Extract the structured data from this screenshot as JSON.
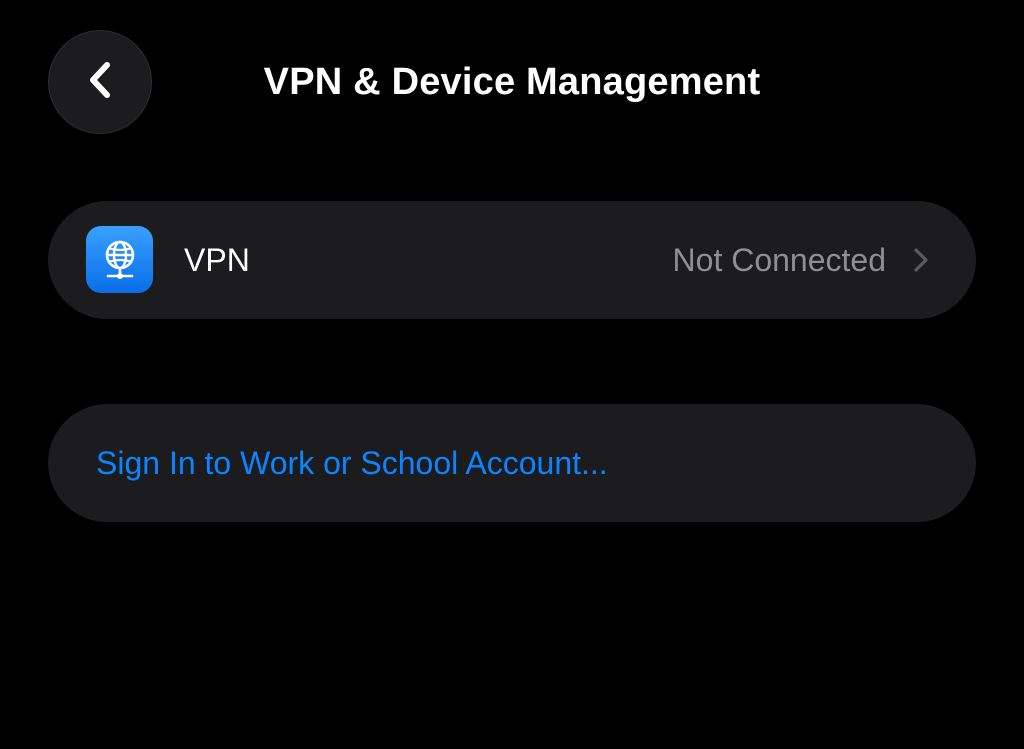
{
  "nav": {
    "back_icon": "chevron-left-icon",
    "title": "VPN & Device Management"
  },
  "vpn_row": {
    "icon": "globe-network-icon",
    "label": "VPN",
    "status": "Not Connected",
    "chevron_icon": "chevron-right-icon"
  },
  "account": {
    "link": "Sign In to Work or School Account..."
  },
  "colors": {
    "background": "#000000",
    "group": "#1c1c1e",
    "accent": "#0a84ff",
    "secondary_text": "#8e8e93",
    "vpn_icon": "#1a84ff"
  }
}
